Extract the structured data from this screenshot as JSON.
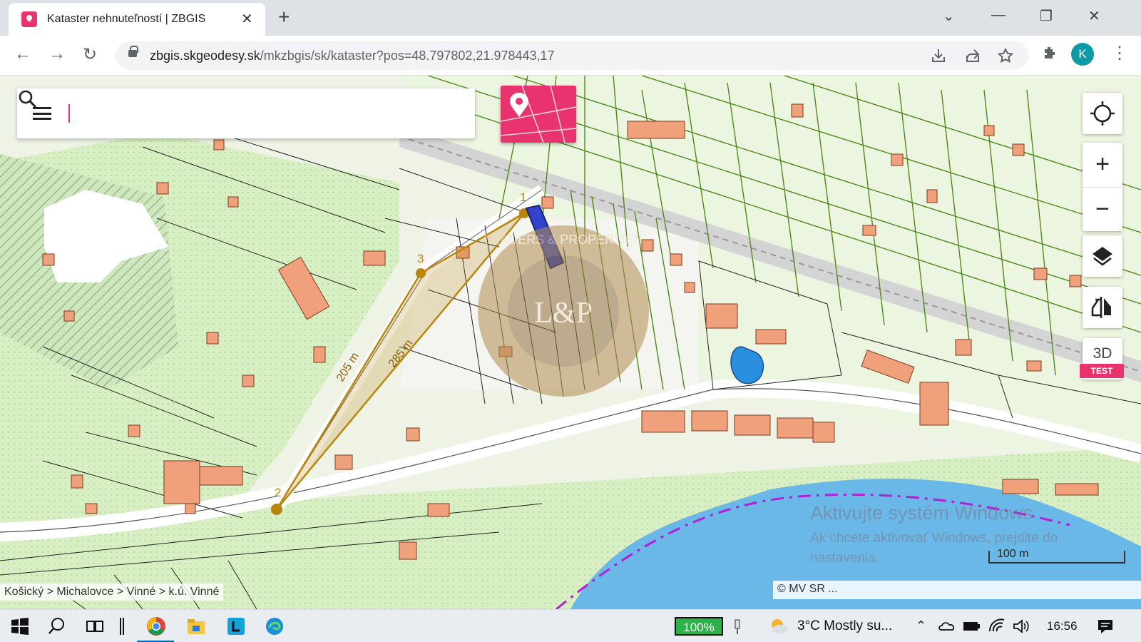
{
  "browser": {
    "tab_title": "Kataster nehnuteľností | ZBGIS",
    "tab_close": "✕",
    "new_tab": "+",
    "url_domain": "zbgis.skgeodesy.sk",
    "url_path": "/mkzbgis/sk/kataster?pos=48.797802,21.978443,17",
    "profile_initial": "K",
    "window_controls": [
      "⌄",
      "—",
      "❐",
      "✕"
    ]
  },
  "map": {
    "search_placeholder": "",
    "zoom_in": "+",
    "zoom_out": "−",
    "mode_3d": "3D",
    "test_badge": "TEST",
    "scale_label": "100 m",
    "attribution": "© MV SR ...",
    "breadcrumb": "Košický > Michalovce > Vinné > k.ú. Vinné",
    "measurement": {
      "points": [
        "1",
        "2",
        "3"
      ],
      "distance_1": "205 m",
      "distance_2": "285 m"
    },
    "watermark_text": "LEADERS & PROPERTIES",
    "watermark_logo": "L&P",
    "windows_activation": {
      "line1": "Aktivujte systém Windows",
      "line2": "Ak chcete aktivovať Windows, prejdite do nastavenia."
    },
    "colors": {
      "parcel_green": "#4e8a1a",
      "building": "#f0a07a",
      "water": "#6ab8e8",
      "measure": "#b8860b",
      "accent": "#e8336f"
    }
  },
  "taskbar": {
    "battery": "100%",
    "weather": "3°C  Mostly su...",
    "time": "16:56"
  }
}
